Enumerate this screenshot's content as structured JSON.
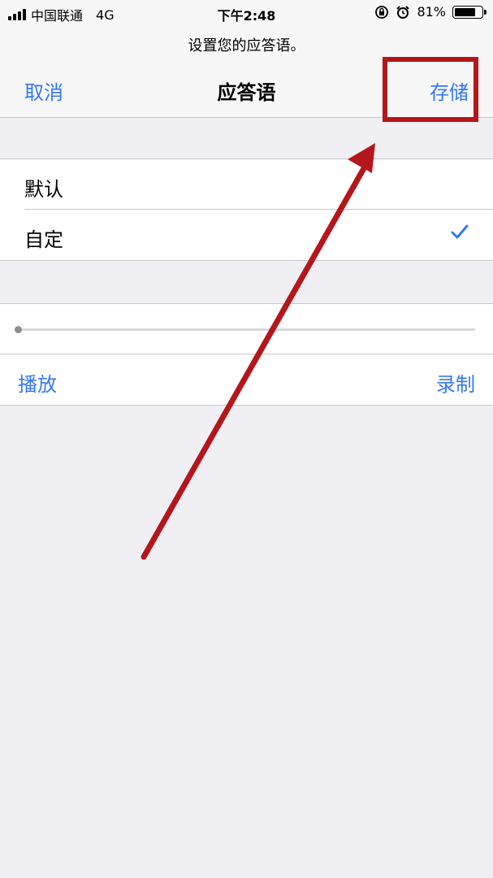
{
  "status_bar": {
    "carrier": "中国联通",
    "network": "4G",
    "time": "下午2:48",
    "battery_percent": "81%",
    "battery_level": 0.81,
    "icons": [
      "signal-icon",
      "rotation-lock-icon",
      "alarm-icon",
      "battery-icon"
    ]
  },
  "navbar": {
    "prompt": "设置您的应答语。",
    "title": "应答语",
    "cancel_label": "取消",
    "save_label": "存储"
  },
  "options": {
    "items": [
      {
        "label": "默认",
        "selected": false
      },
      {
        "label": "自定",
        "selected": true
      }
    ]
  },
  "recording": {
    "playback_progress": 0.0,
    "play_label": "播放",
    "record_label": "录制"
  },
  "colors": {
    "accent": "#3478f6",
    "annotation": "#b5161b",
    "background": "#efeff4"
  }
}
